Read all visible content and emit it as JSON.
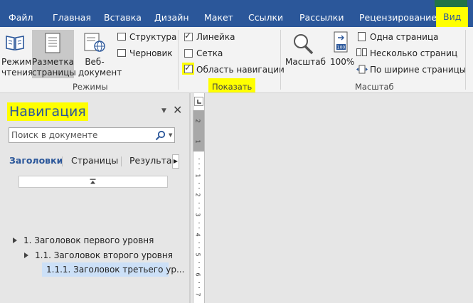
{
  "colors": {
    "ribbon_blue": "#2b579a",
    "highlight_yellow": "#ffff00",
    "selected_gray": "#c8c8c8"
  },
  "tabs": [
    "Файл",
    "Главная",
    "Вставка",
    "Дизайн",
    "Макет",
    "Ссылки",
    "Рассылки",
    "Рецензирование",
    "Вид"
  ],
  "active_tab": "Вид",
  "ribbon": {
    "modes": {
      "mode_read": [
        "Режим",
        "чтения"
      ],
      "page_layout": [
        "Разметка",
        "страницы"
      ],
      "web_doc": [
        "Веб-",
        "документ"
      ],
      "structure": "Структура",
      "draft": "Черновик",
      "group_label": "Режимы"
    },
    "show": {
      "ruler": {
        "label": "Линейка",
        "checked": true
      },
      "grid": {
        "label": "Сетка",
        "checked": false
      },
      "nav_pane": {
        "label": "Область навигации",
        "checked": true
      },
      "group_label": "Показать"
    },
    "zoom": {
      "zoom_label": "Масштаб",
      "hundred": "100%",
      "one_page": "Одна страница",
      "multi_page": "Несколько страниц",
      "page_width": "По ширине страницы",
      "group_label": "Масштаб"
    }
  },
  "nav": {
    "title": "Навигация",
    "search_placeholder": "Поиск в документе",
    "tabs": [
      "Заголовки",
      "Страницы",
      "Результаты"
    ],
    "active_tab": "Заголовки",
    "headings": [
      {
        "level": 1,
        "text": "1. Заголовок первого уровня"
      },
      {
        "level": 2,
        "text": "1.1. Заголовок второго уровня"
      },
      {
        "level": 3,
        "text": "1.1.1. Заголовок третьего ур...",
        "selected": true
      }
    ]
  },
  "ruler": {
    "marks": [
      "2",
      "1",
      "1",
      "2",
      "3",
      "4",
      "5",
      "6",
      "7"
    ]
  }
}
